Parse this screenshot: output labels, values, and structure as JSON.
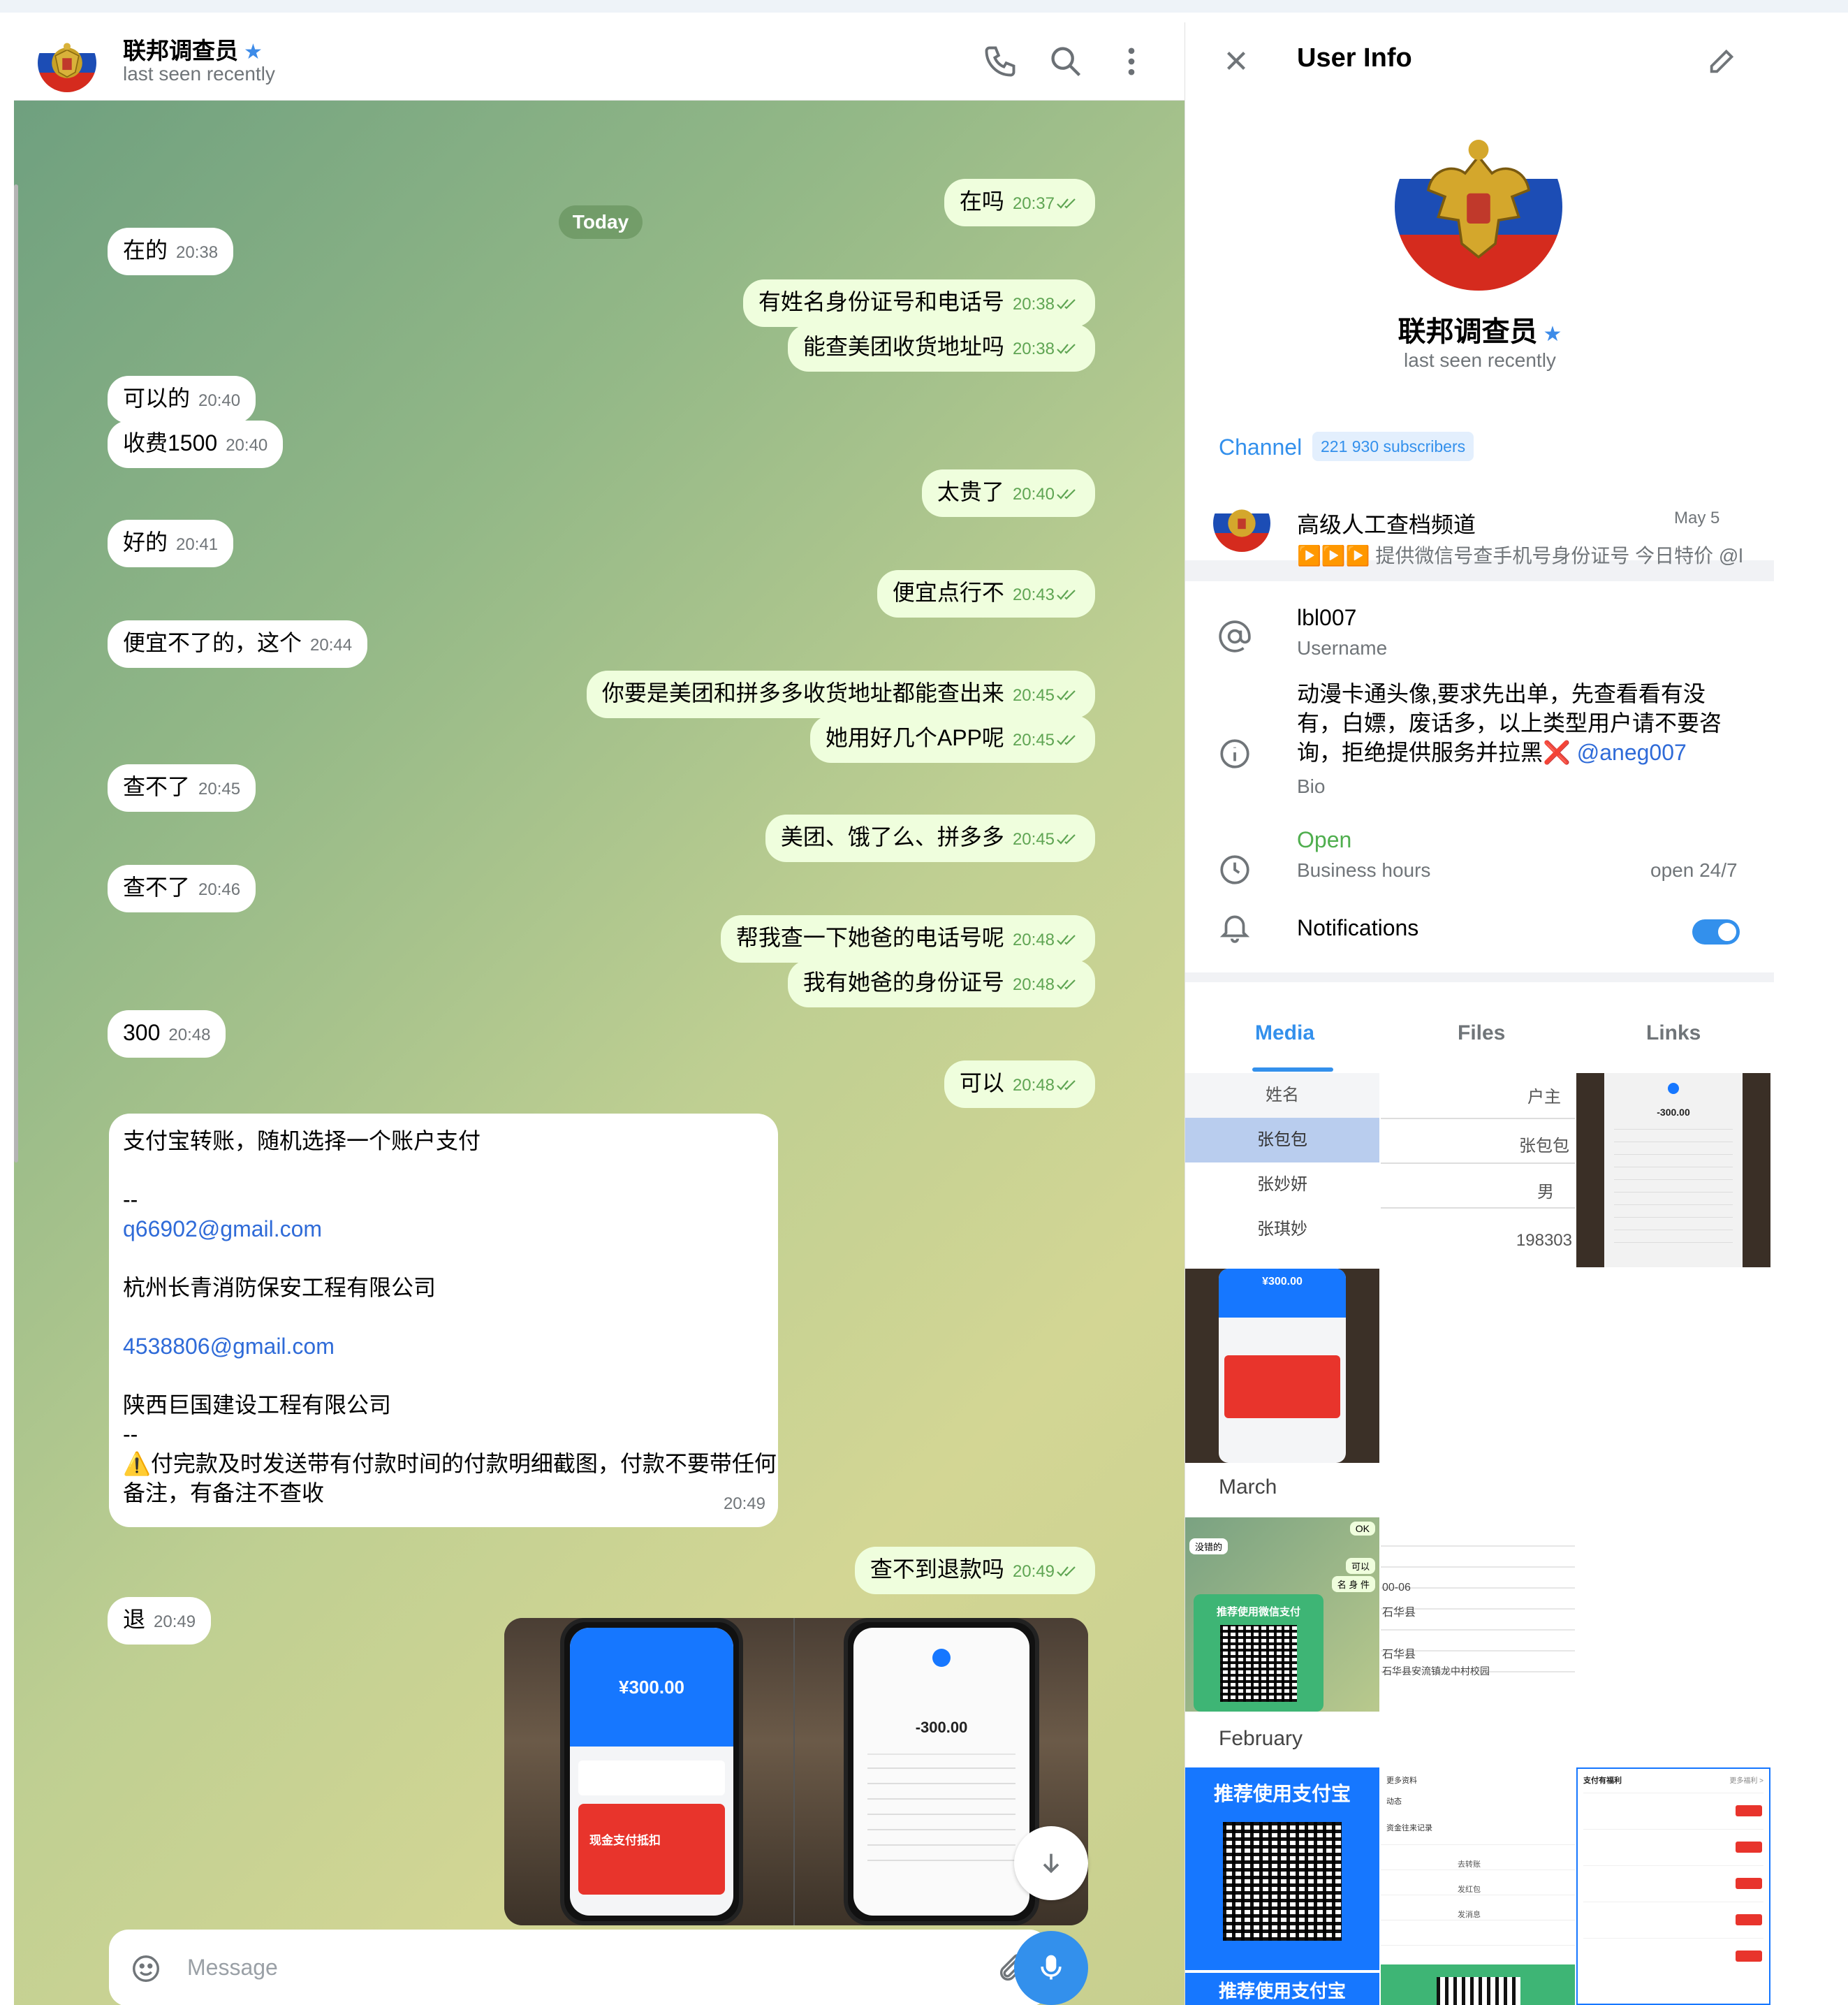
{
  "chat": {
    "name": "联邦调查员",
    "status": "last seen recently",
    "date_badge": "Today",
    "messages": [
      {
        "dir": "out",
        "text": "在吗",
        "time": "20:37"
      },
      {
        "dir": "in",
        "text": "在的",
        "time": "20:38"
      },
      {
        "dir": "out",
        "text": "有姓名身份证号和电话号",
        "time": "20:38"
      },
      {
        "dir": "out",
        "text": "能查美团收货地址吗",
        "time": "20:38"
      },
      {
        "dir": "in",
        "text": "可以的",
        "time": "20:40"
      },
      {
        "dir": "in",
        "text": "收费1500",
        "time": "20:40"
      },
      {
        "dir": "out",
        "text": "太贵了",
        "time": "20:40"
      },
      {
        "dir": "in",
        "text": "好的",
        "time": "20:41"
      },
      {
        "dir": "out",
        "text": "便宜点行不",
        "time": "20:43"
      },
      {
        "dir": "in",
        "text": "便宜不了的，这个",
        "time": "20:44"
      },
      {
        "dir": "out",
        "text": "你要是美团和拼多多收货地址都能查出来",
        "time": "20:45"
      },
      {
        "dir": "out",
        "text": "她用好几个APP呢",
        "time": "20:45"
      },
      {
        "dir": "in",
        "text": "查不了",
        "time": "20:45"
      },
      {
        "dir": "out",
        "text": "美团、饿了么、拼多多",
        "time": "20:45"
      },
      {
        "dir": "in",
        "text": "查不了",
        "time": "20:46"
      },
      {
        "dir": "out",
        "text": "帮我查一下她爸的电话号呢",
        "time": "20:48"
      },
      {
        "dir": "out",
        "text": "我有她爸的身份证号",
        "time": "20:48"
      },
      {
        "dir": "in",
        "text": "300",
        "time": "20:48"
      },
      {
        "dir": "out",
        "text": "可以",
        "time": "20:48"
      },
      {
        "dir": "out",
        "text": "查不到退款吗",
        "time": "20:49"
      },
      {
        "dir": "in",
        "text": "退",
        "time": "20:49"
      }
    ],
    "long_message": {
      "l1": "支付宝转账，随机选择一个账户支付",
      "l2": "--",
      "l3": "q66902@gmail.com",
      "l4": "杭州长青消防保安工程有限公司",
      "l5": "4538806@gmail.com",
      "l6": "陕西巨国建设工程有限公司",
      "l7": "--",
      "l8": "⚠️付完款及时发送带有付款时间的付款明细截图，付款不要带任何",
      "l9": "备注，有备注不查收",
      "time": "20:49"
    },
    "photo_amount_1": "¥300.00",
    "photo_amount_2": "-300.00",
    "photo_promo": "现金支付抵扣",
    "input_placeholder": "Message"
  },
  "user_info": {
    "title": "User Info",
    "name": "联邦调查员",
    "status": "last seen recently",
    "channel_label": "Channel",
    "subscribers": "221 930 subscribers",
    "channel_name": "高级人工查档频道",
    "channel_date": "May 5",
    "channel_preview": "▶️▶️▶️ 提供微信号查手机号身份证号 今日特价 @l...",
    "username": "lbl007",
    "username_label": "Username",
    "bio_line1": "动漫卡通头像,要求先出单，先查看看有没",
    "bio_line2": "有，白嫖，废话多，以上类型用户请不要咨",
    "bio_line3": "询，拒绝提供服务并拉黑",
    "bio_mark": "❌",
    "bio_link": "@aneg007",
    "bio_label": "Bio",
    "hours_status": "Open",
    "hours_label": "Business hours",
    "hours_value": "open 24/7",
    "notifications": "Notifications",
    "notifications_on": true,
    "tabs": [
      "Media",
      "Files",
      "Links"
    ],
    "months": [
      "March",
      "February"
    ],
    "tile_texts": {
      "name_header": "姓名",
      "names": [
        "张包包",
        "张妙妍",
        "张琪妙"
      ],
      "owner_header": "户主",
      "owner_name": "张包包",
      "gender": "男",
      "number": "198303",
      "amount1": "¥300.00",
      "amount2": "-300.00",
      "wechat_pay": "推荐使用微信支付",
      "alipay": "推荐使用支付宝",
      "ok": "OK",
      "wechat_reply": "可以",
      "wechat_name": "没错的",
      "wechat_number": "名 身 件",
      "addr1": "00-06",
      "addr2": "石华县",
      "addr3": "石华县",
      "addr4": "石华县安流镇龙中村校园",
      "menu_more": "更多资料",
      "menu_dynamic": "动态",
      "menu_record": "资金往来记录",
      "menu_transfer": "去转账",
      "menu_redpacket": "发红包",
      "menu_message": "发消息",
      "benefits_title": "支付有福利",
      "benefits_more": "更多福利 >"
    }
  },
  "colors": {
    "accent": "#3390ec",
    "outgoing": "#effedd",
    "tick": "#5fa553"
  }
}
